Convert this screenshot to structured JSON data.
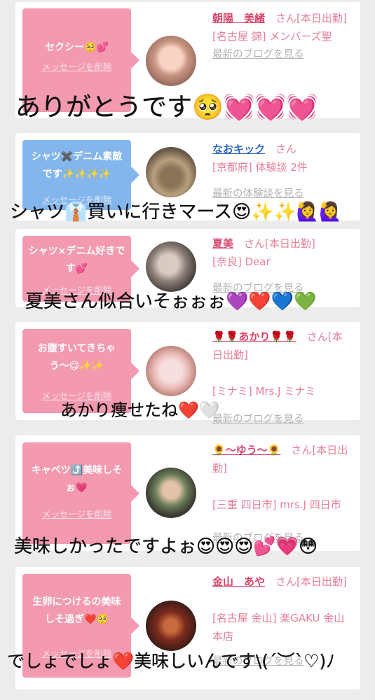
{
  "cards": [
    {
      "bubble_message": "セクシー🥺💕",
      "bubble_delete": "メッセージを削除",
      "name": "朝陽　美緒",
      "suffix": "さん[本日出勤]",
      "location": "[名古屋 錦] メンバーズ聖",
      "latest": "最新のブログを見る",
      "bubble_color": "#f49ab0"
    },
    {
      "bubble_message": "シャツ✖️デニム素敵です✨✨✨✨",
      "bubble_delete": "メッセージを削除",
      "name": "なおキック",
      "suffix": "さん",
      "location": "[京都府] 体験談 2件",
      "latest": "最新の体験談を見る",
      "bubble_color": "#84b6ee"
    },
    {
      "bubble_message": "シャツ×デニム好きです💕",
      "bubble_delete": "メッセージを削除",
      "name": "夏美",
      "suffix": "さん[本日出勤]",
      "location": "[奈良] Dear",
      "latest": "最新のブログを見る",
      "bubble_color": "#f49ab0"
    },
    {
      "bubble_message": "お腹すいてきちゃう〜😋✨✨",
      "bubble_delete": "メッセージを削除",
      "name": "🌹🌹あかり🌹🌹",
      "suffix": "さん[本日出勤]",
      "location": "[ミナミ] Mrs.J ミナミ",
      "latest": "最新のブログを見る",
      "bubble_color": "#f49ab0"
    },
    {
      "bubble_message": "キャベツ⤴️美味しそぉ💗",
      "bubble_delete": "メッセージを削除",
      "name": "🌻〜ゆう〜🌻",
      "suffix": "さん[本日出勤]",
      "location": "[三重 四日市] mrs.J 四日市",
      "latest": "最新のブログを見る",
      "bubble_color": "#f49ab0"
    },
    {
      "bubble_message": "生卵につけるの美味しそ過ぎ❤️🥺",
      "bubble_delete": "メッセージを削除",
      "name": "金山　あや",
      "suffix": "さん[本日出勤]",
      "location": "[名古屋 金山] 楽GAKU 金山本店",
      "latest": "最新のブログを見る",
      "bubble_color": "#f49ab0"
    }
  ],
  "overlays": [
    "ありがとうです🥺💓💓💓",
    "シャツ👔買いに行きマース😍✨✨🙋‍♀️🙋‍♀️",
    "夏美さん似合いそぉぉぉ💜❤️💙💚",
    "あかり痩せたね❤️🤍",
    "美味しかったですよぉ😍😍😍💕💗😳",
    "でしょでしょ❤️美味しいんです\\(´︶`♡)ﾉ"
  ]
}
